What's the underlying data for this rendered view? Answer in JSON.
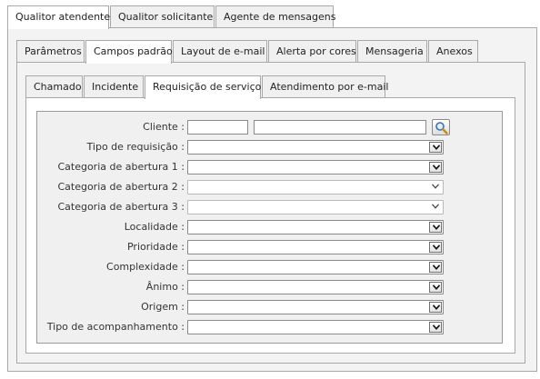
{
  "tabs_level1": [
    "Qualitor atendente",
    "Qualitor solicitante",
    "Agente de mensagens"
  ],
  "tabs_level2": [
    "Parâmetros",
    "Campos padrão",
    "Layout de e-mail",
    "Alerta por cores",
    "Mensageria",
    "Anexos"
  ],
  "tabs_level3": [
    "Chamado",
    "Incidente",
    "Requisição de serviço",
    "Atendimento por e-mail"
  ],
  "form": {
    "cliente_label": "Cliente :",
    "cliente_code": "",
    "cliente_name": "",
    "fields": [
      {
        "label": "Tipo de requisição :",
        "value": ""
      },
      {
        "label": "Categoria de abertura 1 :",
        "value": ""
      },
      {
        "label": "Categoria de abertura 2 :",
        "value": ""
      },
      {
        "label": "Categoria de abertura 3 :",
        "value": ""
      },
      {
        "label": "Localidade :",
        "value": ""
      },
      {
        "label": "Prioridade :",
        "value": ""
      },
      {
        "label": "Complexidade :",
        "value": ""
      },
      {
        "label": "Ânimo :",
        "value": ""
      },
      {
        "label": "Origem :",
        "value": ""
      },
      {
        "label": "Tipo de acompanhamento :",
        "value": ""
      }
    ]
  },
  "icons": {
    "lookup": "search-magnifier-icon",
    "dropdown": "chevron-down-icon"
  },
  "colors": {
    "border": "#a8a8a8",
    "panel_bg": "#f3f3f3",
    "inner_bg": "#f0f0f0"
  }
}
